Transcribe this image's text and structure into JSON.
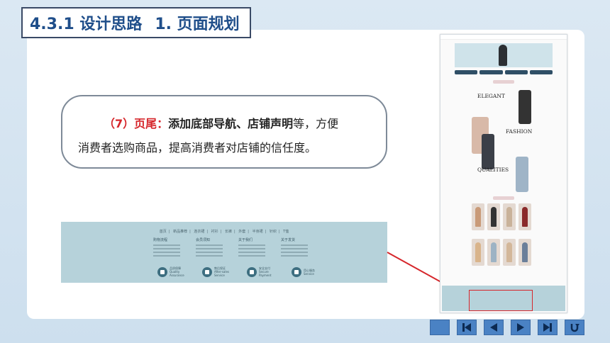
{
  "slide": {
    "section_number": "4.3.1",
    "title": "设计思路",
    "subtitle": "1. 页面规划"
  },
  "callout": {
    "label": "（7）页尾：",
    "highlight": "添加底部导航、店铺声明",
    "rest_line1": "等，方便",
    "line2": "消费者选购商品，提高消费者对店铺的信任度。"
  },
  "footer_preview": {
    "nav_items": [
      "首页",
      "新品推荐",
      "连衣裙",
      "衬衫",
      "长裤",
      "外套",
      "半身裙",
      "针织",
      "T恤"
    ],
    "columns": [
      "购物流程",
      "会员须知",
      "关于我们",
      "关于发货"
    ],
    "promises": [
      {
        "line1": "品质保障",
        "line2": "Quality Assurance",
        "icon": "badge-icon"
      },
      {
        "line1": "售后保证",
        "line2": "After-sales Service",
        "icon": "heart-icon"
      },
      {
        "line1": "安全支付",
        "line2": "Secure Payment",
        "icon": "shield-icon"
      },
      {
        "line1": "用心服务",
        "line2": "Service",
        "icon": "heart-icon"
      }
    ]
  },
  "page_preview": {
    "headings": [
      "ELEGANT",
      "FASHION",
      "QUALITIES"
    ]
  },
  "nav_buttons": [
    {
      "icon": "home-square-icon"
    },
    {
      "icon": "first-page-icon"
    },
    {
      "icon": "previous-icon"
    },
    {
      "icon": "next-icon"
    },
    {
      "icon": "last-page-icon"
    },
    {
      "icon": "return-icon"
    }
  ],
  "colors": {
    "title_text": "#1f4e8a",
    "accent_red": "#d6262b",
    "footer_strip": "#b6d2da",
    "nav_button": "#4a82c4"
  }
}
